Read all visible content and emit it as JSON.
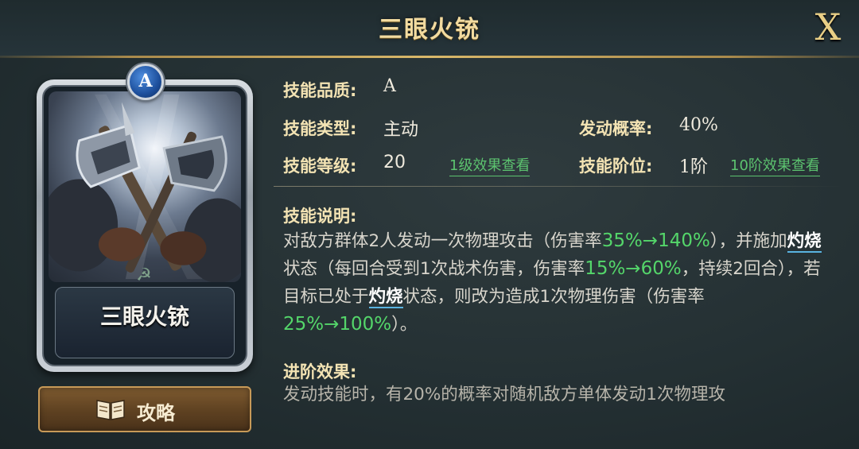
{
  "header": {
    "title": "三眼火铳",
    "close_label": "X"
  },
  "card": {
    "grade": "A",
    "name": "三眼火铳"
  },
  "guide_button": {
    "label": "攻略",
    "icon": "book-icon"
  },
  "skill": {
    "quality_label": "技能品质:",
    "quality_value": "A",
    "type_label": "技能类型:",
    "type_value": "主动",
    "chance_label": "发动概率:",
    "chance_value": "40%",
    "level_label": "技能等级:",
    "level_value": "20",
    "level_link": "1级效果查看",
    "rank_label": "技能阶位:",
    "rank_value": "1阶",
    "rank_link": "10阶效果查看"
  },
  "description": {
    "title": "技能说明:",
    "p1": "对敌方群体2人发动一次物理攻击（伤害率",
    "g1": "35%→140%",
    "p2": "），并施加",
    "kw1": "灼烧",
    "p3": "状态（每回合受到1次战术伤害，伤害率",
    "g2": "15%→60%",
    "p4": "，持续2回合），若目标已处于",
    "kw2": "灼烧",
    "p5": "状态，则改为造成1次物理伤害（伤害率",
    "g3": "25%→100%",
    "p6": "）。"
  },
  "advance": {
    "title": "进阶效果:",
    "text": "发动技能时，有20%的概率对随机敌方单体发动1次物理攻"
  },
  "colors": {
    "accent_gold": "#f2dba0",
    "highlight_green": "#54d66a",
    "keyword_underline": "#59b3e0"
  }
}
